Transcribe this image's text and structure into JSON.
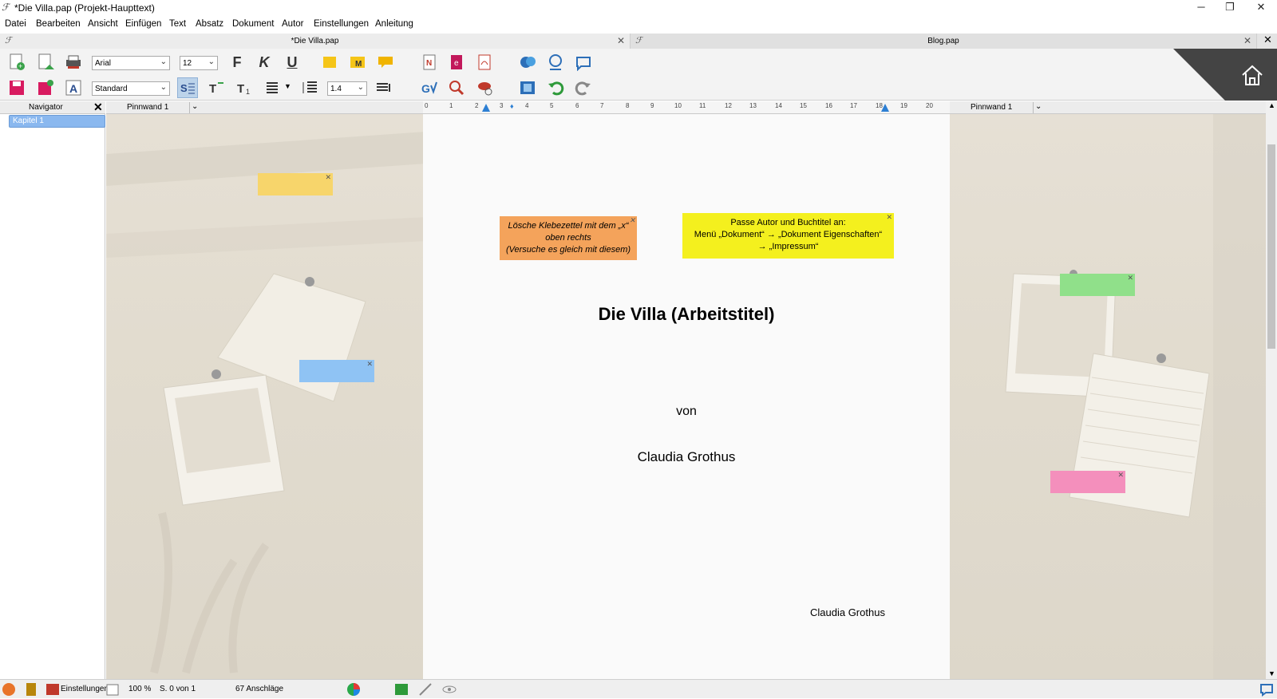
{
  "window": {
    "title": "*Die Villa.pap  (Projekt-Haupttext)",
    "app_icon": "app-quill-icon"
  },
  "menu": [
    "Datei",
    "Bearbeiten",
    "Ansicht",
    "Einfügen",
    "Text",
    "Absatz",
    "Dokument",
    "Autor",
    "Einstellungen",
    "Anleitung"
  ],
  "tabs": [
    {
      "label": "*Die Villa.pap",
      "active": true
    },
    {
      "label": "Blog.pap",
      "active": false
    }
  ],
  "toolbar": {
    "font": "Arial",
    "font_size": "12",
    "style": "Standard",
    "line_spacing": "1.4",
    "bold": "F",
    "italic": "K",
    "underline": "U"
  },
  "navigator": {
    "title": "Navigator",
    "items": [
      "Kapitel 1"
    ]
  },
  "pinboards": {
    "left_label": "Pinnwand 1",
    "right_label": "Pinnwand 1"
  },
  "ruler": {
    "ticks": [
      "0",
      "1",
      "2",
      "3",
      "4",
      "5",
      "6",
      "7",
      "8",
      "9",
      "10",
      "11",
      "12",
      "13",
      "14",
      "15",
      "16",
      "17",
      "18",
      "19",
      "20"
    ]
  },
  "notes": {
    "orange": [
      "Lösche Klebezettel mit dem „x“",
      "oben rechts",
      "(Versuche es gleich mit diesem)"
    ],
    "yellow": [
      "Passe Autor und Buchtitel an:",
      "Menü „Dokument“ → „Dokument Eigenschaften“",
      "→ „Impressum“"
    ]
  },
  "document": {
    "title": "Die Villa (Arbeitstitel)",
    "von": "von",
    "author": "Claudia Grothus",
    "footer_author": "Claudia Grothus"
  },
  "statusbar": {
    "settings": "Einstellungen",
    "zoom": "100 %",
    "page": "S. 0 von 1",
    "chars": "67 Anschläge"
  },
  "colors": {
    "orange_note": "#f4a35b",
    "yellow_note": "#f4f01e",
    "board_bg": "#e3ddd1",
    "nav_highlight": "#8ab8ef"
  }
}
